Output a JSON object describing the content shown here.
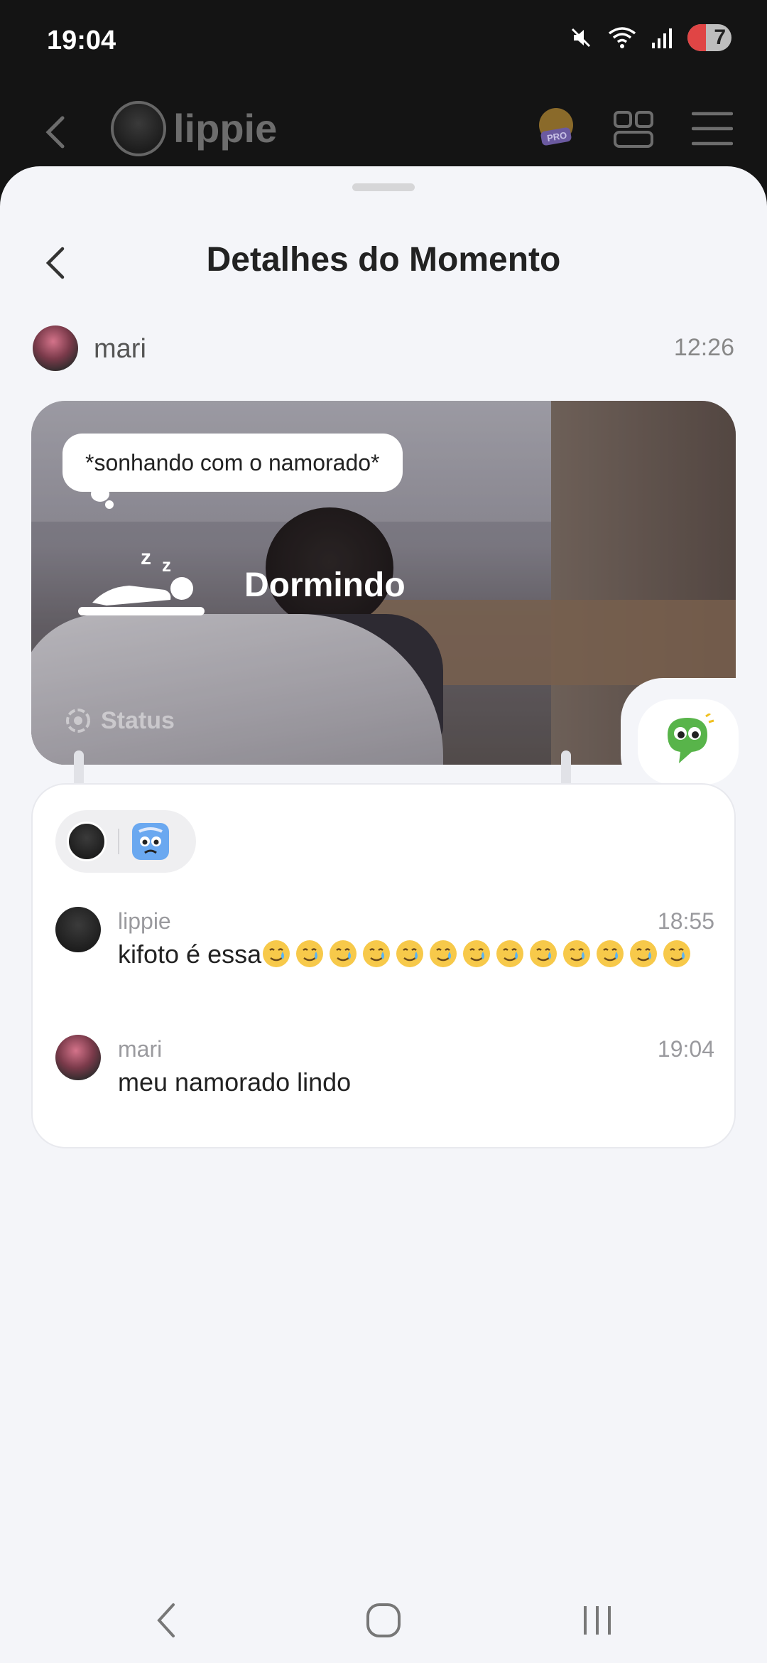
{
  "status_bar": {
    "time": "19:04",
    "battery": "7",
    "icons": [
      "mute-icon",
      "wifi-icon",
      "signal-icon",
      "battery-icon"
    ]
  },
  "app_bar": {
    "user_name": "lippie",
    "pro_badge": "PRO",
    "icons": [
      "back-arrow-icon",
      "grid-icon",
      "menu-icon"
    ]
  },
  "sheet": {
    "title": "Detalhes do Momento",
    "author": {
      "name": "mari",
      "time": "12:26"
    },
    "moment": {
      "thought": "*sonhando com o namorado*",
      "mood": "Dormindo",
      "tag": "Status"
    },
    "comments": [
      {
        "author": "lippie",
        "time": "18:55",
        "text": "kifoto é essa",
        "emoji_count": 13,
        "emoji": "smiling-tear"
      },
      {
        "author": "mari",
        "time": "19:04",
        "text": "meu namorado lindo"
      }
    ]
  },
  "colors": {
    "sheet_bg": "#f4f5f9",
    "accent_green": "#58b44a",
    "text_primary": "#222222",
    "text_muted": "#9a9a9e"
  }
}
